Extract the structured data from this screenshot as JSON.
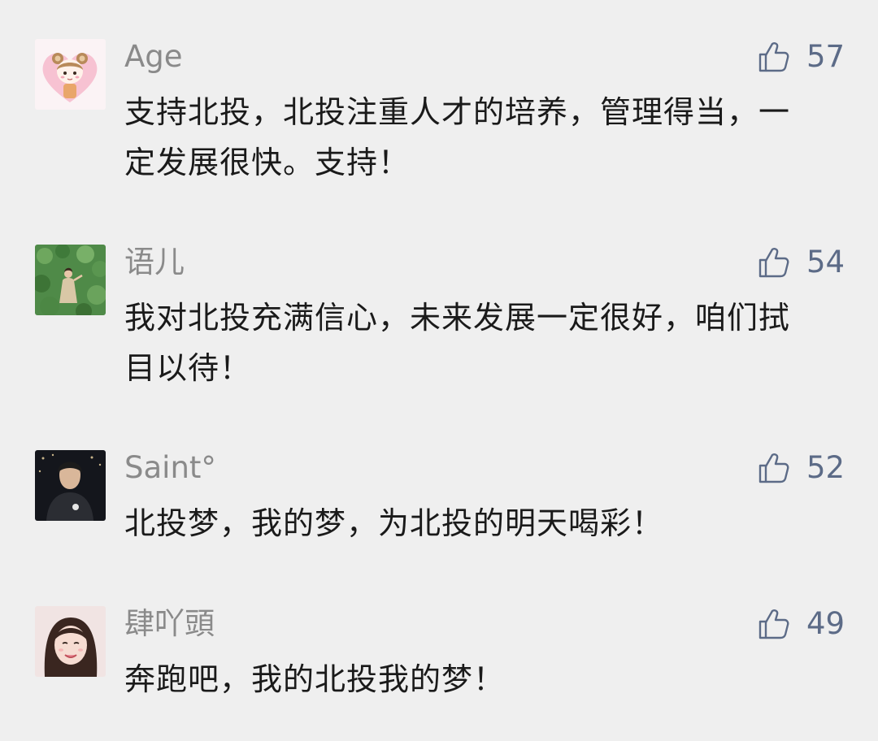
{
  "comments": [
    {
      "nickname": "Age",
      "content": "支持北投，北投注重人才的培养，管理得当，一定发展很快。支持！",
      "likes": "57",
      "avatar_icon": "bear-ears-cartoon-girl-avatar"
    },
    {
      "nickname": "语儿",
      "content": "我对北投充满信心，未来发展一定很好，咱们拭目以待！",
      "likes": "54",
      "avatar_icon": "woman-in-green-field-avatar"
    },
    {
      "nickname": "Saint°",
      "content": "北投梦，我的梦，为北投的明天喝彩！",
      "likes": "52",
      "avatar_icon": "man-in-dark-hoodie-avatar"
    },
    {
      "nickname": "肆吖頭",
      "content": "奔跑吧，我的北投我的梦！",
      "likes": "49",
      "avatar_icon": "smiling-girl-avatar"
    }
  ],
  "colors": {
    "background": "#efefef",
    "nickname": "#8a8a8a",
    "content": "#1a1a1a",
    "like": "#5c6b87"
  }
}
